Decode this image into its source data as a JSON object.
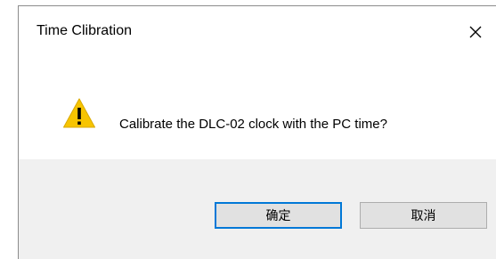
{
  "window": {
    "title": "Time Clibration",
    "close_label": "×"
  },
  "dialog": {
    "icon": "warning-icon",
    "message": "Calibrate the DLC-02 clock with the PC time?"
  },
  "buttons": {
    "ok_label": "确定",
    "cancel_label": "取消"
  },
  "colors": {
    "warning_fill": "#f7c400",
    "focus_border": "#0078d7",
    "footer_bg": "#f0f0f0"
  }
}
